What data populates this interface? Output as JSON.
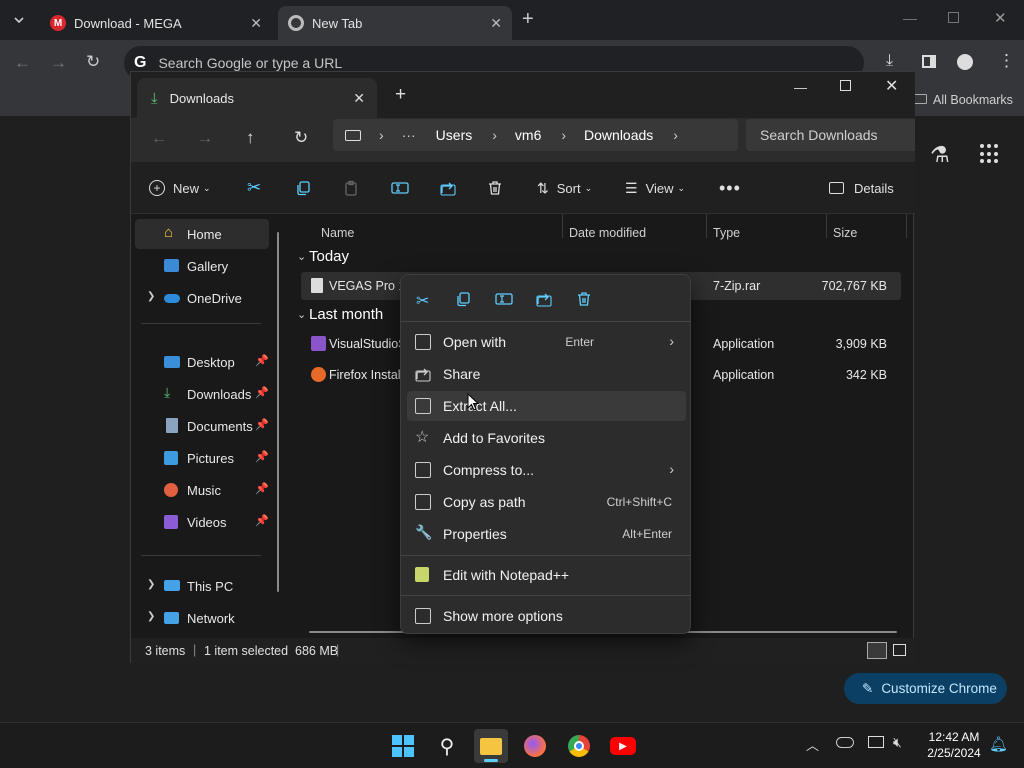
{
  "chrome": {
    "tabs": [
      {
        "title": "Download - MEGA"
      },
      {
        "title": "New Tab"
      }
    ],
    "omnibox_placeholder": "Search Google or type a URL",
    "bookmarks_label": "All Bookmarks",
    "customize_label": "Customize Chrome"
  },
  "explorer": {
    "tab_title": "Downloads",
    "breadcrumb": [
      "Users",
      "vm6",
      "Downloads"
    ],
    "search_placeholder": "Search Downloads",
    "commands": {
      "new": "New",
      "sort": "Sort",
      "view": "View",
      "details": "Details"
    },
    "nav": {
      "home": "Home",
      "gallery": "Gallery",
      "onedrive": "OneDrive",
      "desktop": "Desktop",
      "downloads": "Downloads",
      "documents": "Documents",
      "pictures": "Pictures",
      "music": "Music",
      "videos": "Videos",
      "thispc": "This PC",
      "network": "Network"
    },
    "columns": {
      "name": "Name",
      "date": "Date modified",
      "type": "Type",
      "size": "Size"
    },
    "groups": {
      "today": "Today",
      "last_month": "Last month"
    },
    "files": [
      {
        "name": "VEGAS Pro 17",
        "type": "7-Zip.rar",
        "size": "702,767 KB"
      },
      {
        "name": "VisualStudioS",
        "type": "Application",
        "size": "3,909 KB"
      },
      {
        "name": "Firefox Installe",
        "type": "Application",
        "size": "342 KB"
      }
    ],
    "status": {
      "count": "3 items",
      "selection": "1 item selected  686 MB"
    }
  },
  "context_menu": {
    "items": [
      {
        "label": "Open with",
        "shortcut": "Enter"
      },
      {
        "label": "Share",
        "shortcut": ""
      },
      {
        "label": "Extract All...",
        "shortcut": ""
      },
      {
        "label": "Add to Favorites",
        "shortcut": ""
      },
      {
        "label": "Compress to...",
        "shortcut": ""
      },
      {
        "label": "Copy as path",
        "shortcut": "Ctrl+Shift+C"
      },
      {
        "label": "Properties",
        "shortcut": "Alt+Enter"
      },
      {
        "label": "Edit with Notepad++",
        "shortcut": ""
      },
      {
        "label": "Show more options",
        "shortcut": ""
      }
    ]
  },
  "taskbar": {
    "time": "12:42 AM",
    "date": "2/25/2024"
  },
  "colors": {
    "accent": "#60cdff",
    "folder": "#f5c542",
    "chrome_accent": "#0b3f63"
  }
}
